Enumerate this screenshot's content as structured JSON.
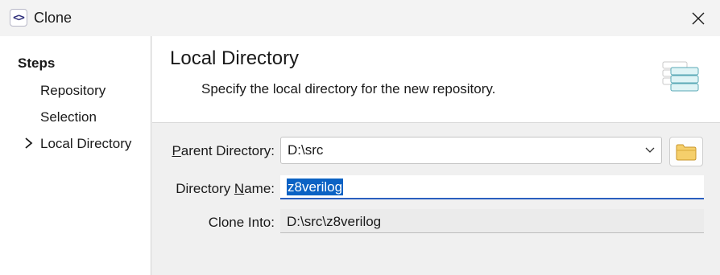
{
  "window": {
    "app_icon": "code-brackets-icon",
    "title": "Clone",
    "close_icon": "close-icon"
  },
  "sidebar": {
    "title": "Steps",
    "steps": [
      {
        "label": "Repository",
        "current": false
      },
      {
        "label": "Selection",
        "current": false
      },
      {
        "label": "Local Directory",
        "current": true
      }
    ]
  },
  "header": {
    "title": "Local Directory",
    "description": "Specify the local directory for the new repository.",
    "icon": "stacked-layers-icon"
  },
  "form": {
    "parent_directory": {
      "label_mnemonic": "P",
      "label_rest": "arent Directory:",
      "value": "D:\\src",
      "browse_icon": "folder-icon"
    },
    "directory_name": {
      "label_pre": "Directory ",
      "label_mnemonic": "N",
      "label_rest": "ame:",
      "value": "z8verilog"
    },
    "clone_into": {
      "label": "Clone Into:",
      "value": "D:\\src\\z8verilog"
    }
  }
}
